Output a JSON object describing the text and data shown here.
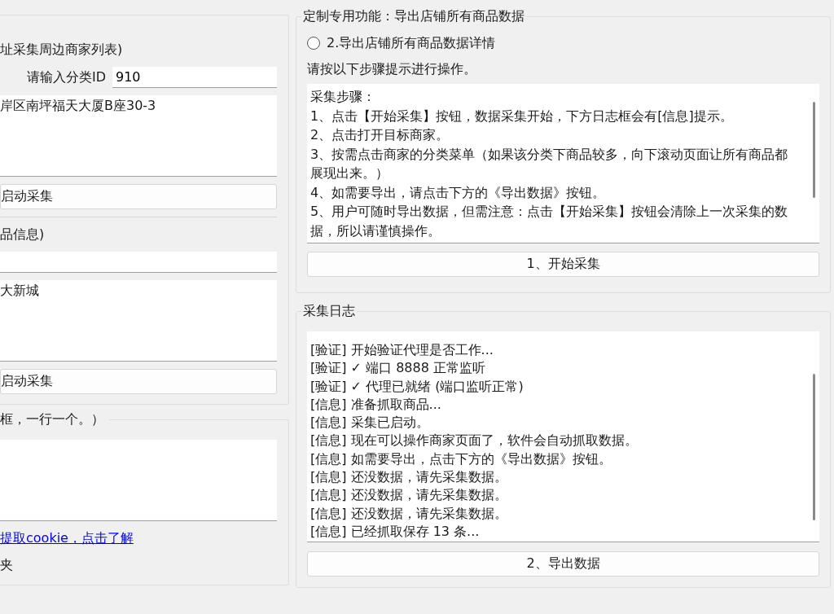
{
  "left_groups": [
    {
      "title": "址采集周边商家列表)",
      "category_label": "请输入分类ID",
      "category_value": "910",
      "address_value": "岸区南坪福天大厦B座30-3",
      "button": "启动采集",
      "sub_title": "品信息)",
      "sub_address_value": "大新城",
      "sub_button": "启动采集"
    },
    {
      "title": "框，一行一个。）",
      "link": "提取cookie，点击了解",
      "note": "夹"
    }
  ],
  "export_group": {
    "title": "定制专用功能：导出店铺所有商品数据",
    "radio": {
      "label": "2.导出店铺所有商品数据详情",
      "selected": false
    },
    "hint": "请按以下步骤提示进行操作。",
    "steps": [
      "采集步骤：",
      "1、点击【开始采集】按钮，数据采集开始，下方日志框会有[信息]提示。",
      "2、点击打开目标商家。",
      "3、按需点击商家的分类菜单（如果该分类下商品较多，向下滚动页面让所有商品都展现出来。）",
      "4、如需要导出，请点击下方的《导出数据》按钮。",
      "5、用户可随时导出数据，但需注意：点击【开始采集】按钮会清除上一次采集的数据，所以请谨慎操作。"
    ],
    "button": "1、开始采集"
  },
  "log_group": {
    "title": "采集日志",
    "lines": [
      "[验证] 开始验证代理是否工作...",
      "[验证] ✓ 端口 8888 正常监听",
      "[验证] ✓ 代理已就绪 (端口监听正常)",
      "[信息] 准备抓取商品...",
      "[信息] 采集已启动。",
      "[信息] 现在可以操作商家页面了，软件会自动抓取数据。",
      "[信息] 如需要导出，点击下方的《导出数据》按钮。",
      "[信息] 还没数据，请先采集数据。",
      "[信息] 还没数据，请先采集数据。",
      "[信息] 还没数据，请先采集数据。",
      "[信息] 已经抓取保存 13 条..."
    ],
    "button": "2、导出数据"
  }
}
